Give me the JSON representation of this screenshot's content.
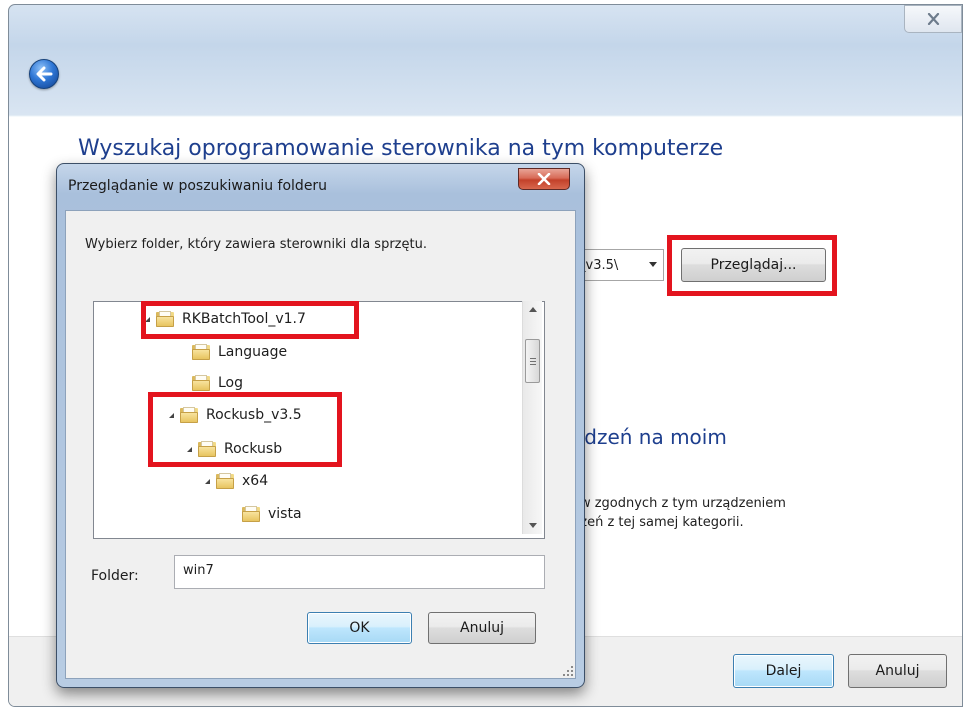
{
  "wizard": {
    "heading": "Wyszukaj oprogramowanie sterownika na tym komputerze",
    "path_value": "_v3.5\\",
    "browse_button": "Przeglądaj...",
    "section_heading": "ądzeń na moim",
    "section_desc_line1": "ów zgodnych z tym urządzeniem",
    "section_desc_line2": "dzeń z tej samej kategorii.",
    "next_button": "Dalej",
    "cancel_button": "Anuluj"
  },
  "dialog": {
    "title": "Przeglądanie w poszukiwaniu folderu",
    "description": "Wybierz folder, który zawiera sterowniki dla sprzętu.",
    "tree": [
      {
        "label": "RKBatchTool_v1.7",
        "expanded": true
      },
      {
        "label": "Language",
        "expanded": false
      },
      {
        "label": "Log",
        "expanded": false
      },
      {
        "label": "Rockusb_v3.5",
        "expanded": true
      },
      {
        "label": "Rockusb",
        "expanded": true
      },
      {
        "label": "x64",
        "expanded": true
      },
      {
        "label": "vista",
        "expanded": false
      }
    ],
    "folder_label": "Folder:",
    "folder_value": "win7",
    "ok_button": "OK",
    "cancel_button": "Anuluj"
  },
  "colors": {
    "highlight_box": "#e3141e",
    "heading_blue": "#1e3f8e",
    "focus_button": "#bee6fd"
  },
  "icons": [
    "close-icon",
    "back-arrow-icon",
    "folder-icon",
    "dropdown-arrow-icon",
    "scroll-up-icon",
    "scroll-down-icon",
    "resize-grip-icon"
  ]
}
